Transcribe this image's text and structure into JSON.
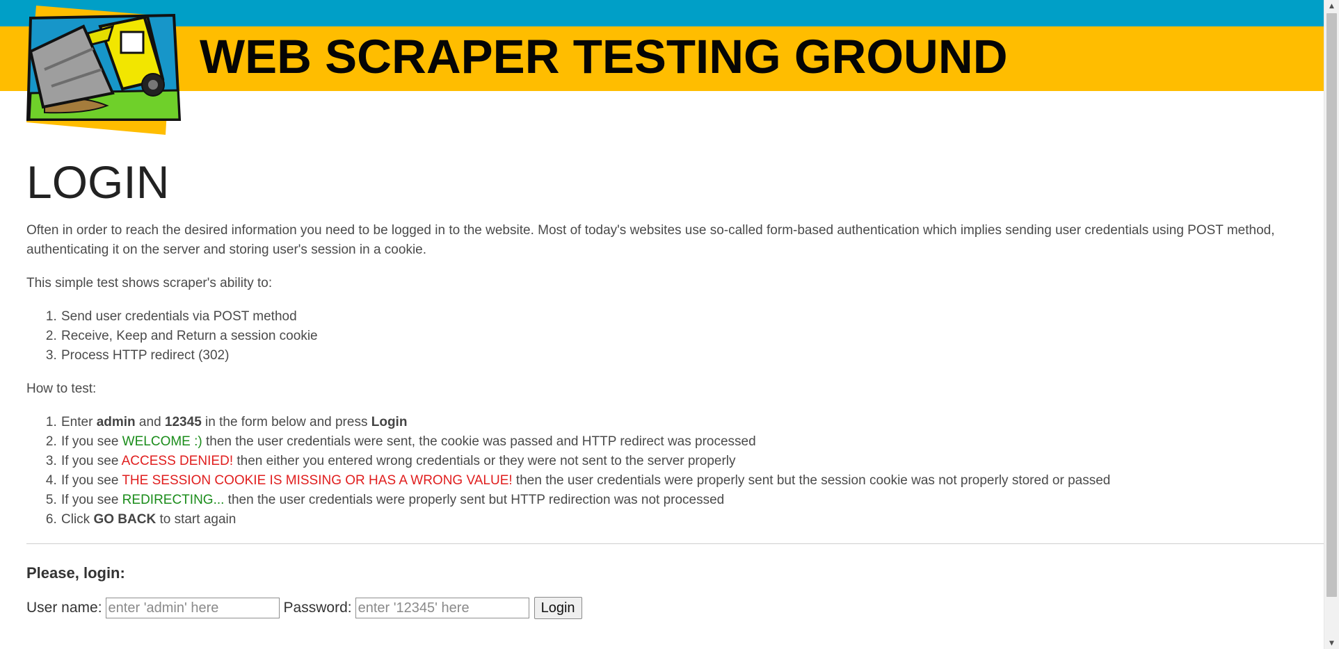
{
  "header": {
    "site_title": "WEB SCRAPER TESTING GROUND",
    "colors": {
      "blue_bar": "#009fc7",
      "yellow_bar": "#ffbd00"
    },
    "logo_icon": "bulldozer-logo-icon"
  },
  "main": {
    "title": "LOGIN",
    "intro": "Often in order to reach the desired information you need to be logged in to the website. Most of today's websites use so-called form-based authentication which implies sending user credentials using POST method, authenticating it on the server and storing user's session in a cookie.",
    "abilities_heading": "This simple test shows scraper's ability to:",
    "abilities": [
      "Send user credentials via POST method",
      "Receive, Keep and Return a session cookie",
      "Process HTTP redirect (302)"
    ],
    "howto_heading": "How to test:",
    "steps": {
      "s1": {
        "a": "Enter ",
        "b1": "admin",
        "c": " and ",
        "b2": "12345",
        "d": " in the form below and press ",
        "b3": "Login"
      },
      "s2": {
        "a": "If you see ",
        "status": "WELCOME :)",
        "rest": " then the user credentials were sent, the cookie was passed and HTTP redirect was processed"
      },
      "s3": {
        "a": "If you see ",
        "status": "ACCESS DENIED!",
        "rest": " then either you entered wrong credentials or they were not sent to the server properly"
      },
      "s4": {
        "a": "If you see ",
        "status": "THE SESSION COOKIE IS MISSING OR HAS A WRONG VALUE!",
        "rest": " then the user credentials were properly sent but the session cookie was not properly stored or passed"
      },
      "s5": {
        "a": "If you see ",
        "status": "REDIRECTING...",
        "rest": " then the user credentials were properly sent but HTTP redirection was not processed"
      },
      "s6": {
        "a": "Click ",
        "b1": "GO BACK",
        "rest": " to start again"
      }
    },
    "status_colors": {
      "success": "#1a8c1a",
      "error": "#e01e1e"
    }
  },
  "form": {
    "heading": "Please, login:",
    "username_label": "User name:",
    "username_placeholder": "enter 'admin' here",
    "username_value": "",
    "password_label": "Password:",
    "password_placeholder": "enter '12345' here",
    "password_value": "",
    "submit_label": "Login"
  }
}
